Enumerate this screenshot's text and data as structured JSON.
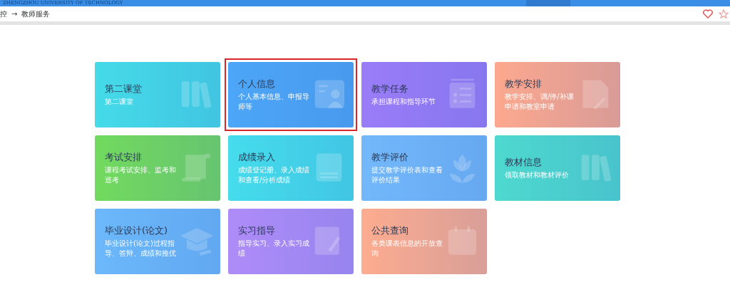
{
  "header": {
    "university": "ZHENGZHOU UNIVERSITY OF TECHNOLOGY"
  },
  "breadcrumb": {
    "items": [
      "控",
      "教师服务"
    ],
    "separator": "→"
  },
  "cards": [
    {
      "title": "第二课堂",
      "description": "第二课堂",
      "kind": "books",
      "color": "#45dbe9",
      "selected": false
    },
    {
      "title": "个人信息",
      "description": "个人基本信息、申报导师等",
      "kind": "idcard",
      "color": "#4da6f7",
      "selected": true
    },
    {
      "title": "教学任务",
      "description": "承担课程和指导环节",
      "kind": "checklist",
      "color": "#9a7cf8",
      "selected": false
    },
    {
      "title": "教学安排",
      "description": "教学安排、调/停/补课申请和教室申请",
      "kind": "document",
      "color": "#fda88e",
      "selected": false
    },
    {
      "title": "考试安排",
      "description": "课程考试安排、监考和巡考",
      "kind": "scroll",
      "color": "#72da5e",
      "selected": false
    },
    {
      "title": "成绩录入",
      "description": "成绩登记册、录入成绩和查看/分析成绩",
      "kind": "grade",
      "color": "#45dcec",
      "selected": false
    },
    {
      "title": "教学评价",
      "description": "提交教学评价表和查看评价结果",
      "kind": "flower",
      "color": "#73b8fb",
      "selected": false
    },
    {
      "title": "教材信息",
      "description": "领取教材和教材评价",
      "kind": "books",
      "color": "#4ed9cf",
      "selected": false
    },
    {
      "title": "毕业设计(论文)",
      "description": "毕业设计(论文)过程指导、答辩、成绩和推优",
      "kind": "cap",
      "color": "#6cb8fb",
      "selected": false
    },
    {
      "title": "实习指导",
      "description": "指导实习、录入实习成绩",
      "kind": "notepad",
      "color": "#ae8cf8",
      "selected": false
    },
    {
      "title": "公共查询",
      "description": "各类课表信息的开放查询",
      "kind": "calendar",
      "color": "#fdac8f",
      "selected": false
    }
  ]
}
